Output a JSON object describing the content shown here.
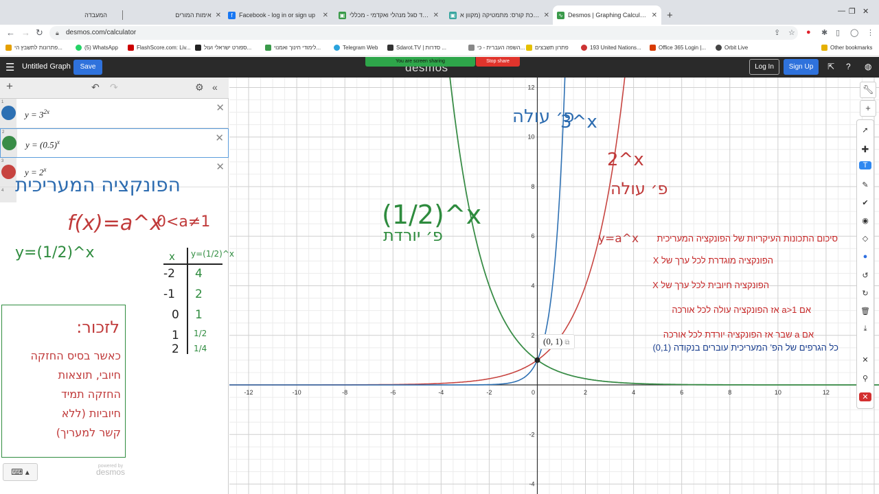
{
  "browser": {
    "tabs": [
      {
        "title": "המעבדה",
        "active": false
      },
      {
        "title": "אימות המורים",
        "active": false
      },
      {
        "title": "Facebook - log in or sign up",
        "active": false
      },
      {
        "title": "עמוד סגל מנהלי ואקדמי - מכללי",
        "active": false
      },
      {
        "title": "עריכת קורס: מתמטיקה (מקוון א",
        "active": false
      },
      {
        "title": "Desmos | Graphing Calculator",
        "active": true
      }
    ],
    "new_tab": "+",
    "url": "desmos.com/calculator",
    "bookmarks": [
      "פתרונות לתשבץ הי...",
      "(5) WhatsApp",
      "FlashScore.com: Liv...",
      "ספורט ישראלי ועול...",
      "לימודי חינוך ואמנוי...",
      "Telegram Web",
      "Sdarot.TV | סדרות ...",
      "השפה העברית - כי...",
      "פתרון תשבצים",
      "193 United Nations...",
      "Office 365 Login |...",
      "Orbit Live",
      "Other bookmarks"
    ]
  },
  "desmos": {
    "graph_title": "Untitled Graph",
    "save": "Save",
    "logo": "desmos",
    "sharing_notice": "You are screen sharing",
    "stop_share": "Stop share",
    "login": "Log In",
    "signup": "Sign Up",
    "expressions": [
      {
        "num": "1",
        "latex_base": "y = 3",
        "sup": "2x",
        "color": "#2d70b3"
      },
      {
        "num": "2",
        "latex_base": "y = (0.5)",
        "sup": "x",
        "color": "#388c46"
      },
      {
        "num": "3",
        "latex_base": "y = 2",
        "sup": "x",
        "color": "#c74440"
      }
    ],
    "row4_num": "4",
    "powered_by": "powered by",
    "powered_logo": "desmos",
    "point_label": "(0, 1)"
  },
  "graph": {
    "x_range": [
      -12.8,
      14.2
    ],
    "y_range": [
      -4.4,
      12.4
    ],
    "x_ticks": [
      "-12",
      "-10",
      "-8",
      "-6",
      "-4",
      "-2",
      "0",
      "2",
      "4",
      "6",
      "8",
      "10",
      "12"
    ],
    "y_ticks": [
      "12",
      "10",
      "8",
      "6",
      "4",
      "2",
      "-2",
      "-4"
    ],
    "colors": {
      "blue": "#2d70b3",
      "green": "#388c46",
      "red": "#c74440"
    }
  },
  "notes": {
    "panel_title": "הפונקציה המעריכית",
    "general_form": "f(x)=a^x",
    "condition": "0<a≠1",
    "example": "y=(1/2)^x",
    "table_header_x": "x",
    "table_header_y": "y=(1/2)^x",
    "table_x": [
      "-2",
      "-1",
      "0",
      "1",
      "2"
    ],
    "table_y": [
      "4",
      "2",
      "1",
      "1/2",
      "1/4"
    ],
    "remember_title": "לזכור:",
    "remember_lines": [
      "כאשר בסיס החזקה",
      "חיובי, תוצאות",
      "החזקה תמיד",
      "חיוביות (ללא",
      "קשר למעריך)"
    ],
    "green_label": "פ׳ יורדת",
    "green_func": "(1/2)^x",
    "blue_label": "פ׳ עולה",
    "blue_func": "3^x",
    "red_func": "2^x",
    "red_label": "פ׳ עולה",
    "summary_title": "סיכום התכונות העיקריות של הפונקציה המעריכית",
    "summary_func": "y=a^x",
    "summary_lines": [
      "הפונקציה מוגדרת לכל ערך של X",
      "הפונקציה חיובית לכל ערך של X",
      "אם a>1 אז הפונקציה עולה לכל אורכה",
      "אם a שבר אז הפונקציה יורדת לכל אורכה",
      "כל הגרפים של הפ' המעריכית עוברים בנקודה (0,1)"
    ]
  }
}
